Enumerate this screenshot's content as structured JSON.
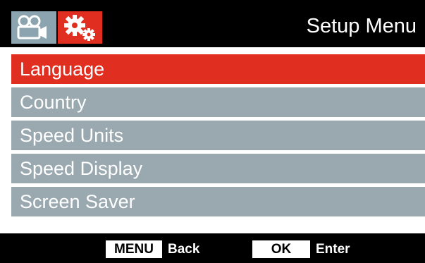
{
  "header": {
    "title": "Setup Menu",
    "tabs": [
      {
        "name": "video",
        "icon": "video-camera-icon",
        "color": "#8ba4b0"
      },
      {
        "name": "setup",
        "icon": "gears-icon",
        "color": "#e02e20"
      }
    ]
  },
  "menu": {
    "items": [
      {
        "label": "Language",
        "selected": true
      },
      {
        "label": "Country",
        "selected": false
      },
      {
        "label": "Speed Units",
        "selected": false
      },
      {
        "label": "Speed Display",
        "selected": false
      },
      {
        "label": "Screen Saver",
        "selected": false
      }
    ]
  },
  "footer": {
    "menu_key": "MENU",
    "back_label": "Back",
    "ok_key": "OK",
    "enter_label": "Enter"
  },
  "colors": {
    "accent": "#e02e20",
    "item": "#9aa9b0",
    "background": "#000000"
  }
}
